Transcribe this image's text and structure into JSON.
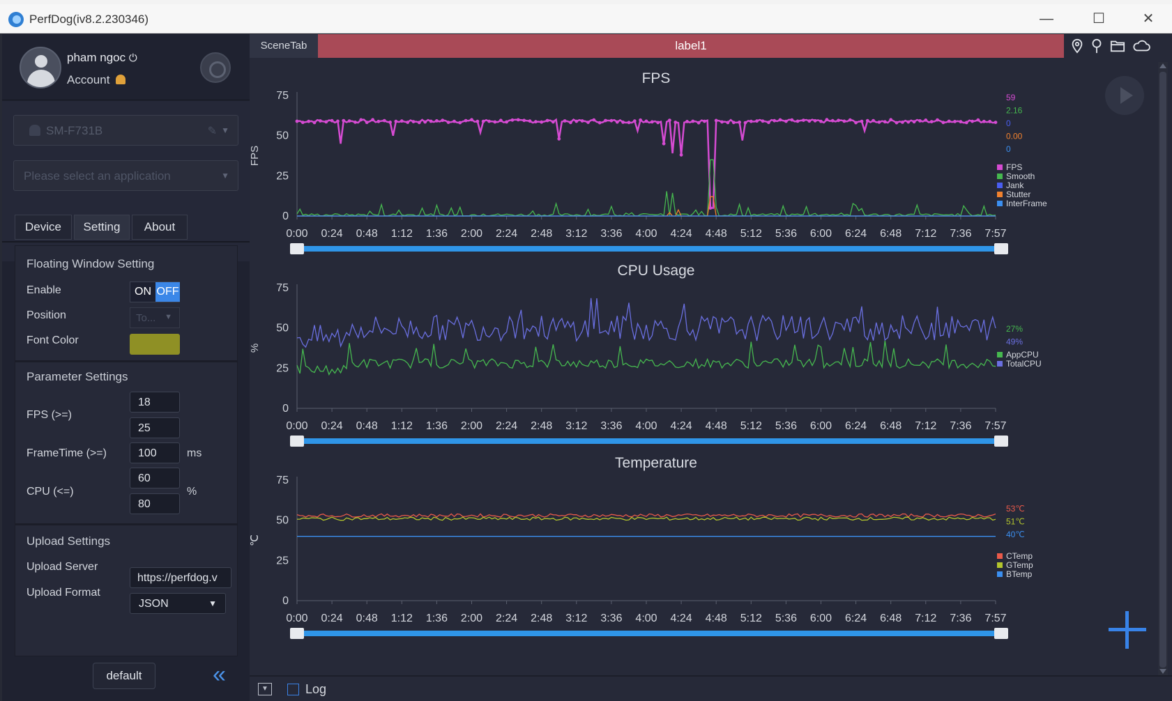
{
  "window": {
    "title": "PerfDog(iv8.2.230346)",
    "minimize": "—",
    "maximize": "☐",
    "close": "✕"
  },
  "user": {
    "name": "pham ngoc",
    "power_icon": "⏻",
    "account_label": "Account"
  },
  "device": {
    "name": "SM-F731B",
    "app_placeholder": "Please select an application"
  },
  "tabs": [
    {
      "label": "Device"
    },
    {
      "label": "Setting",
      "active": true
    },
    {
      "label": "About"
    }
  ],
  "floating_window": {
    "title": "Floating Window Setting",
    "enable_label": "Enable",
    "on_label": "ON",
    "off_label": "OFF",
    "enabled": false,
    "position_label": "Position",
    "position_value": "To...",
    "font_color_label": "Font Color",
    "font_color": "#8f9025"
  },
  "parameters": {
    "title": "Parameter Settings",
    "fps_label": "FPS (>=)",
    "fps_values": [
      "18",
      "25"
    ],
    "frametime_label": "FrameTime (>=)",
    "frametime_value": "100",
    "frametime_unit": "ms",
    "cpu_label": "CPU (<=)",
    "cpu_values": [
      "60",
      "80"
    ],
    "cpu_unit": "%"
  },
  "upload": {
    "title": "Upload Settings",
    "server_label": "Upload Server",
    "server_value": "https://perfdog.v",
    "format_label": "Upload Format",
    "format_value": "JSON"
  },
  "default_button": "default",
  "collapse_icon": "«",
  "content": {
    "scene_tab": "SceneTab",
    "label": "label1",
    "tool_icons": [
      "location-pin-icon",
      "pin-icon",
      "folder-icon",
      "cloud-icon"
    ],
    "log_label": "Log",
    "accent": "#3883e8"
  },
  "chart_data": [
    {
      "type": "line",
      "title": "FPS",
      "ylabel": "FPS",
      "ylim": [
        0,
        75
      ],
      "yticks": [
        0,
        25,
        50,
        75
      ],
      "x_ticks": [
        "0:00",
        "0:24",
        "0:48",
        "1:12",
        "1:36",
        "2:00",
        "2:24",
        "2:48",
        "3:12",
        "3:36",
        "4:00",
        "4:24",
        "4:48",
        "5:12",
        "5:36",
        "6:00",
        "6:24",
        "6:48",
        "7:12",
        "7:36",
        "7:57"
      ],
      "current_values": [
        {
          "text": "59",
          "color": "#d54bd2"
        },
        {
          "text": "2.16",
          "color": "#46b84f"
        },
        {
          "text": "0",
          "color": "#4a5ef0"
        },
        {
          "text": "0.00",
          "color": "#f0812e"
        },
        {
          "text": "0",
          "color": "#3b8ff0"
        }
      ],
      "series": [
        {
          "name": "FPS",
          "color": "#d54bd2",
          "baseline": 59,
          "dips": [
            {
              "t": 0.5,
              "v": 45
            },
            {
              "t": 1.1,
              "v": 50
            },
            {
              "t": 2.1,
              "v": 52
            },
            {
              "t": 3.0,
              "v": 48
            },
            {
              "t": 3.9,
              "v": 53
            },
            {
              "t": 4.2,
              "v": 45
            },
            {
              "t": 4.3,
              "v": 39
            },
            {
              "t": 4.4,
              "v": 38
            },
            {
              "t": 4.75,
              "v": 5
            },
            {
              "t": 5.1,
              "v": 47
            },
            {
              "t": 6.5,
              "v": 53
            }
          ]
        },
        {
          "name": "Smooth",
          "color": "#46b84f",
          "baseline": 2
        },
        {
          "name": "Jank",
          "color": "#4a5ef0",
          "baseline": 0
        },
        {
          "name": "Stutter",
          "color": "#f0812e",
          "baseline": 0
        },
        {
          "name": "InterFrame",
          "color": "#3b8ff0",
          "baseline": 0
        }
      ]
    },
    {
      "type": "line",
      "title": "CPU Usage",
      "ylabel": "%",
      "ylim": [
        0,
        75
      ],
      "yticks": [
        0,
        25,
        50,
        75
      ],
      "x_ticks": [
        "0:00",
        "0:24",
        "0:48",
        "1:12",
        "1:36",
        "2:00",
        "2:24",
        "2:48",
        "3:12",
        "3:36",
        "4:00",
        "4:24",
        "4:48",
        "5:12",
        "5:36",
        "6:00",
        "6:24",
        "6:48",
        "7:12",
        "7:36",
        "7:57"
      ],
      "current_values": [
        {
          "text": "27%",
          "color": "#46b84f"
        },
        {
          "text": "49%",
          "color": "#6a6fe0"
        }
      ],
      "series": [
        {
          "name": "AppCPU",
          "color": "#46b84f",
          "baseline": 28
        },
        {
          "name": "TotalCPU",
          "color": "#6a6fe0",
          "baseline": 50
        }
      ]
    },
    {
      "type": "line",
      "title": "Temperature",
      "ylabel": "℃",
      "ylim": [
        0,
        75
      ],
      "yticks": [
        0,
        25,
        50,
        75
      ],
      "x_ticks": [
        "0:00",
        "0:24",
        "0:48",
        "1:12",
        "1:36",
        "2:00",
        "2:24",
        "2:48",
        "3:12",
        "3:36",
        "4:00",
        "4:24",
        "4:48",
        "5:12",
        "5:36",
        "6:00",
        "6:24",
        "6:48",
        "7:12",
        "7:36",
        "7:57"
      ],
      "current_values": [
        {
          "text": "53℃",
          "color": "#ea5a4a"
        },
        {
          "text": "51℃",
          "color": "#b3c52d"
        },
        {
          "text": "40℃",
          "color": "#3b8ff0"
        }
      ],
      "series": [
        {
          "name": "CTemp",
          "color": "#ea5a4a",
          "baseline": 53
        },
        {
          "name": "GTemp",
          "color": "#b3c52d",
          "baseline": 51
        },
        {
          "name": "BTemp",
          "color": "#3b8ff0",
          "baseline": 40
        }
      ]
    }
  ]
}
